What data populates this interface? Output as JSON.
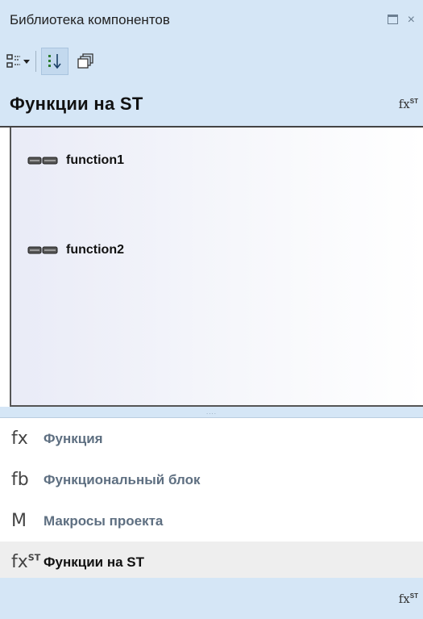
{
  "window": {
    "title": "Библиотека компонентов",
    "close_glyph": "×"
  },
  "toolbar": {
    "buttons": [
      {
        "icon": "view-mode-icon",
        "has_dropdown": true
      },
      {
        "icon": "sort-icon",
        "active": true
      },
      {
        "icon": "collapse-icon"
      }
    ]
  },
  "group": {
    "title": "Функции на ST",
    "icon_text": "fx",
    "icon_sup": "ST"
  },
  "items": [
    {
      "label": "function1",
      "icon": "function-block-icon"
    },
    {
      "label": "function2",
      "icon": "function-block-icon"
    }
  ],
  "splitter": "....",
  "categories": [
    {
      "symbol": "fx",
      "sup": "",
      "name": "Функция"
    },
    {
      "symbol": "fb",
      "sup": "",
      "name": "Функциональный блок"
    },
    {
      "symbol": "M",
      "sup": "",
      "name": "Макросы проекта"
    },
    {
      "symbol": "fx",
      "sup": "ST",
      "name": "Функции на ST",
      "selected": true
    }
  ],
  "bottom": {
    "icon_text": "fx",
    "icon_sup": "ST"
  },
  "colors": {
    "panel_blue": "#d5e6f6",
    "selected_row": "#eeeeee",
    "category_text": "#5e6f81"
  }
}
